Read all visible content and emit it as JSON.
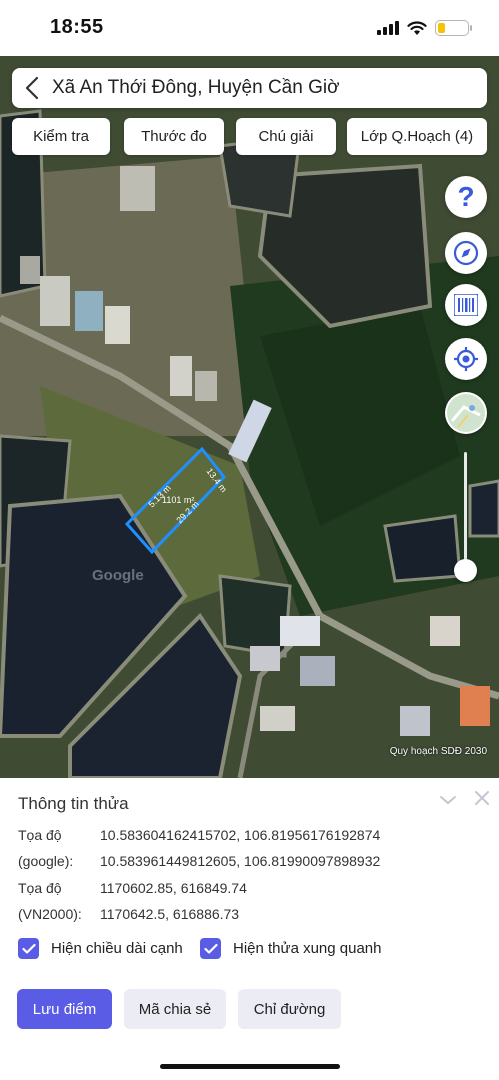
{
  "status_bar": {
    "time": "18:55",
    "battery_level": 0.25,
    "battery_color": "#f5c400"
  },
  "map": {
    "search": {
      "title": "Xã An Thới Đông, Huyện Cần Giờ"
    },
    "tabs": [
      {
        "label": "Kiểm tra"
      },
      {
        "label": "Thước đo"
      },
      {
        "label": "Chú giải"
      },
      {
        "label": "Lớp Q.Hoạch (4)"
      }
    ],
    "controls": {
      "help_glyph": "?",
      "icons": [
        "help-icon",
        "compass-icon",
        "barcode-icon",
        "locate-icon",
        "map-layer-icon"
      ]
    },
    "parcel": {
      "color": "#1e90ff",
      "edge_labels": [
        "13.4 m",
        "5.13 m",
        "29.2 m"
      ],
      "area_label": "1101 m²"
    },
    "watermark": "Google",
    "credit": "Quy hoạch SDĐ 2030"
  },
  "panel": {
    "title": "Thông tin thửa",
    "coords": [
      {
        "label": "Tọa độ",
        "value": "10.583604162415702, 106.81956176192874"
      },
      {
        "label": "(google):",
        "value": "10.583961449812605, 106.81990097898932"
      },
      {
        "label": "Tọa độ",
        "value": "1170602.85, 616849.74"
      },
      {
        "label": "(VN2000):",
        "value": "1170642.5, 616886.73"
      }
    ],
    "checkboxes": [
      {
        "label": "Hiện chiều dài cạnh",
        "checked": true
      },
      {
        "label": "Hiện thửa xung quanh",
        "checked": true
      }
    ],
    "buttons": {
      "save": "Lưu điểm",
      "share": "Mã chia sẻ",
      "directions": "Chỉ đường"
    },
    "accent_color": "#5b5ce6"
  }
}
